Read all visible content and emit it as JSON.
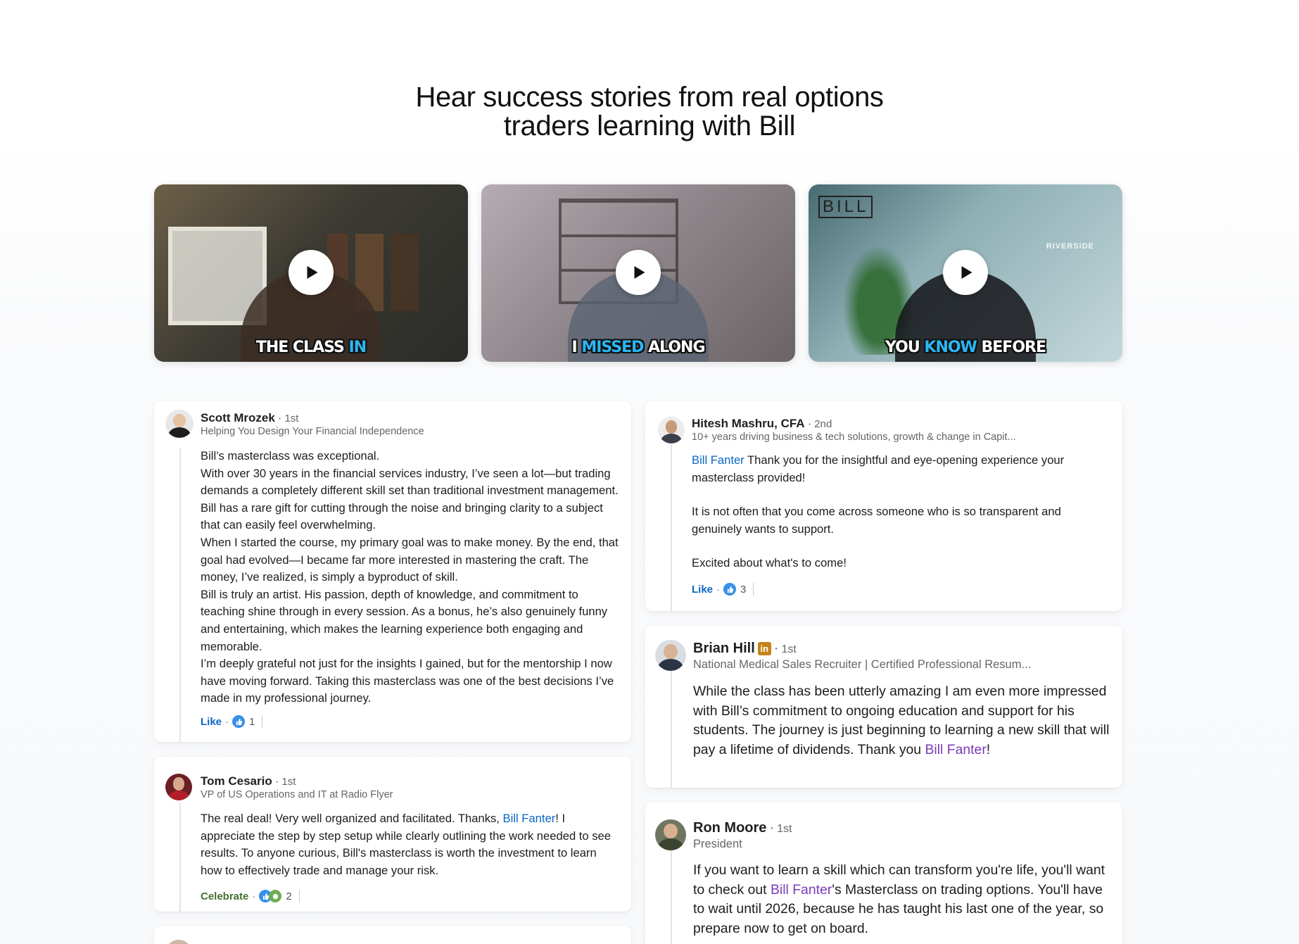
{
  "heading": {
    "line1": "Hear success stories from real options",
    "line2": "traders learning with Bill"
  },
  "videos": [
    {
      "caption_pre": "THE CLASS ",
      "caption_hl": "IN",
      "caption_post": "",
      "icon": "play-icon"
    },
    {
      "caption_pre": "I ",
      "caption_hl": "MISSED",
      "caption_post": " ALONG",
      "icon": "play-icon"
    },
    {
      "caption_pre": "YOU ",
      "caption_hl": "KNOW",
      "caption_post": " BEFORE",
      "overlay_logo": "BILL",
      "overlay_brand": "RIVERSIDE",
      "icon": "play-icon"
    }
  ],
  "testimonials": {
    "scott": {
      "name": "Scott Mrozek",
      "degree": "1st",
      "headline": "Helping You Design Your Financial Independence",
      "paragraphs": [
        "Bill’s masterclass was exceptional.",
        "With over 30 years in the financial services industry, I’ve seen a lot—but trading demands a completely different skill set than traditional investment management. Bill has a rare gift for cutting through the noise and bringing clarity to a subject that can easily feel overwhelming.",
        "When I started the course, my primary goal was to make money. By the end, that goal had evolved—I became far more interested in mastering the craft. The money, I’ve realized, is simply a byproduct of skill.",
        "Bill is truly an artist. His passion, depth of knowledge, and commitment to teaching shine through in every session. As a bonus, he’s also genuinely funny and entertaining, which makes the learning experience both engaging and memorable.",
        "I’m deeply grateful not just for the insights I gained, but for the mentorship I now have moving forward. Taking this masterclass was one of the best decisions I’ve made in my professional journey."
      ],
      "reaction_label": "Like",
      "reaction_count": "1"
    },
    "tom": {
      "name": "Tom Cesario",
      "degree": "1st",
      "headline": "VP of US Operations and IT at Radio Flyer",
      "text_before": "The real deal! Very well organized and facilitated. Thanks, ",
      "mention": "Bill Fanter",
      "text_after": "! I appreciate the step by step setup while clearly outlining the work needed to see results. To anyone curious, Bill's masterclass is worth the investment to learn how to effectively trade and manage your risk.",
      "reaction_label": "Celebrate",
      "reaction_count": "2"
    },
    "hitesh": {
      "name": "Hitesh Mashru, CFA",
      "degree": "2nd",
      "headline": "10+ years driving business & tech solutions, growth & change in Capit...",
      "mention": "Bill Fanter",
      "text_first": " Thank you for the insightful and eye-opening experience your masterclass provided!",
      "text_second": "It is not often that you come across someone who is so transparent and genuinely wants to support.",
      "text_third": "Excited about what's to come!",
      "reaction_label": "Like",
      "reaction_count": "3"
    },
    "brian": {
      "name": "Brian Hill",
      "badge": "in",
      "degree": "1st",
      "headline": "National Medical Sales Recruiter | Certified Professional Resum...",
      "text_before": "While the class has been utterly amazing I am even more impressed with Bill’s commitment to ongoing education and support for his students.  The journey is just beginning to learning a new skill that will pay a lifetime of dividends.  Thank you ",
      "mention": "Bill Fanter",
      "text_after": "!"
    },
    "ron": {
      "name": "Ron Moore",
      "degree": "1st",
      "headline": "President",
      "text_before": "If you want to learn a skill which can transform you're life, you'll want to check out ",
      "mention": "Bill Fanter",
      "text_after": "'s Masterclass on trading options. You'll have to wait until 2026, because he has taught his last one of the year, so prepare now to get on board."
    }
  },
  "colors": {
    "link_blue": "#0a66c2",
    "mention_purple": "#7d3ab8",
    "celebrate_green": "#44712e",
    "caption_highlight": "#2bb6f4"
  }
}
